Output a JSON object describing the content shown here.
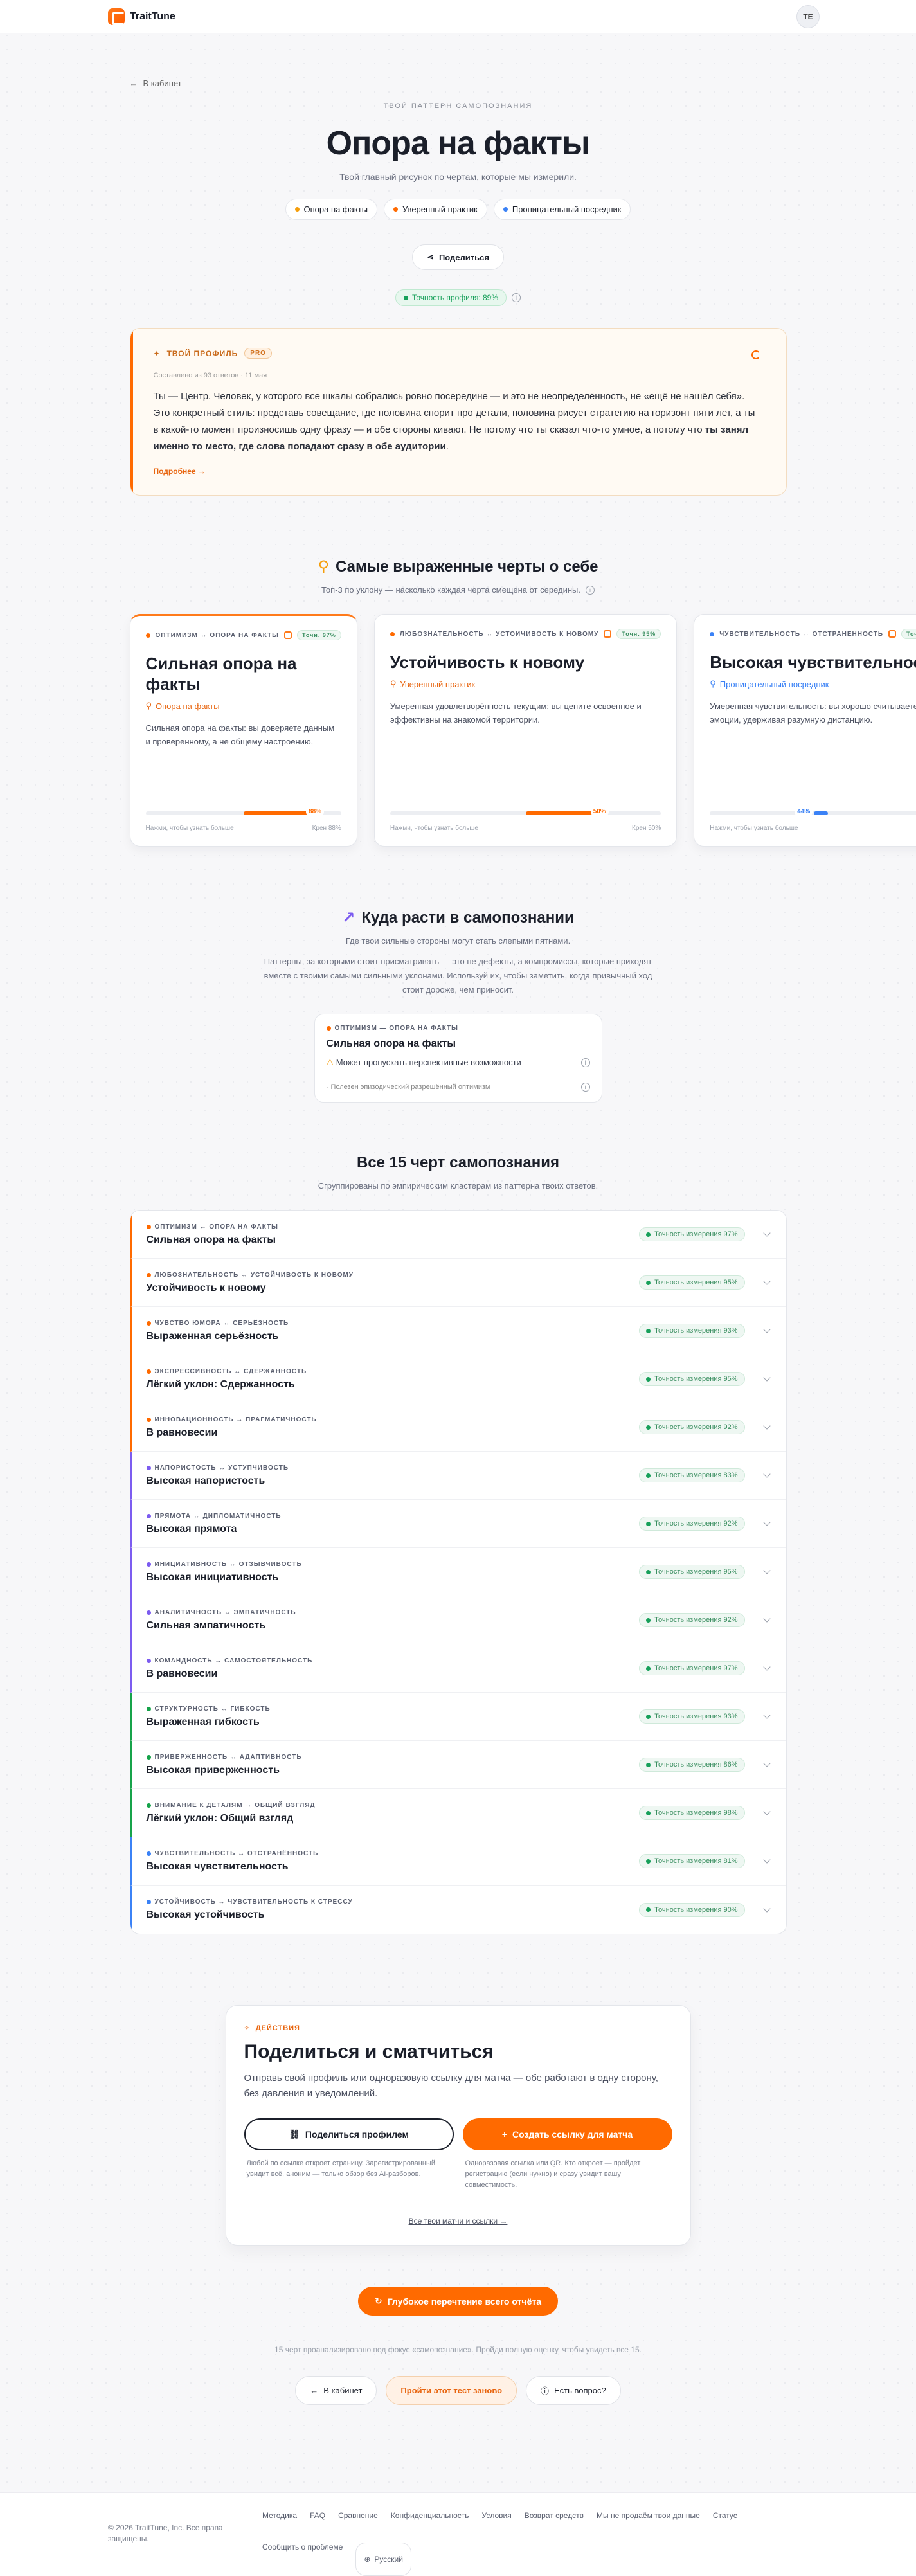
{
  "header": {
    "brand": "TraitTune",
    "avatar": "TE"
  },
  "back": "В кабинет",
  "hero": {
    "eyebrow": "ТВОЙ ПАТТЕРН САМОПОЗНАНИЯ",
    "title": "Опора на факты",
    "subtitle": "Твой главный рисунок по чертам, которые мы измерили.",
    "chips": [
      {
        "label": "Опора на факты",
        "color": "#f59e0b"
      },
      {
        "label": "Уверенный практик",
        "color": "#ff6a00"
      },
      {
        "label": "Проницательный посредник",
        "color": "#3b82f6"
      }
    ],
    "share": "Поделиться",
    "accuracy": "Точность профиля: 89%"
  },
  "profile": {
    "label": "ТВОЙ ПРОФИЛЬ",
    "badge": "PRO",
    "meta": "Составлено из 93 ответов · 11 мая",
    "text": "Ты — Центр. Человек, у которого все шкалы собрались ровно посередине — и это не неопределённость, не «ещё не нашёл себя». Это конкретный стиль: представь совещание, где половина спорит про детали, половина рисует стратегию на горизонт пяти лет, а ты в какой-то момент произносишь одну фразу — и обе стороны кивают. Не потому что ты сказал что-то умное, а потому что",
    "bold": "ты занял именно то место, где слова попадают сразу в обе аудитории",
    "more": "Подробнее →"
  },
  "top": {
    "title": "Самые выраженные черты о себе",
    "subtitle": "Топ-3 по уклону — насколько каждая черта смещена от середины.",
    "cards": [
      {
        "label": "ОПТИМИЗМ ↔ ОПОРА НА ФАКТЫ",
        "acc": "Точн. 97%",
        "title": "Сильная опора на факты",
        "pattern": "Опора на факты",
        "pcolor": "#e8650f",
        "dot": "#ff6a00",
        "desc": "Сильная опора на факты: вы доверяете данным и проверенному, а не общему настроению.",
        "value": 0.88,
        "vlabel": "88%",
        "bcolor": "#ff6a00",
        "hint": "Нажми, чтобы узнать больше",
        "pole": "Крен 88%"
      },
      {
        "label": "ЛЮБОЗНАТЕЛЬНОСТЬ ↔ УСТОЙЧИВОСТЬ К НОВОМУ",
        "acc": "Точн. 95%",
        "title": "Устойчивость к новому",
        "pattern": "Уверенный практик",
        "pcolor": "#e8650f",
        "dot": "#ff6a00",
        "desc": "Умеренная удовлетворённость текущим: вы цените освоенное и эффективны на знакомой территории.",
        "value": 0.8,
        "vlabel": "50%",
        "bcolor": "#ff6a00",
        "hint": "Нажми, чтобы узнать больше",
        "pole": "Крен 50%"
      },
      {
        "label": "ЧУВСТВИТЕЛЬНОСТЬ ↔ ОТСТРАНЁННОСТЬ",
        "acc": "Точн. 81%",
        "title": "Высокая чувствительность",
        "pattern": "Проницательный посредник",
        "pcolor": "#3b82f6",
        "dot": "#3b82f6",
        "desc": "Умеренная чувствительность: вы хорошо считываете эмоции, удерживая разумную дистанцию.",
        "value": 0.44,
        "vlabel": "44%",
        "bcolor": "#3b82f6",
        "hint": "Нажми, чтобы узнать больше",
        "pole": "Крен 44%"
      }
    ]
  },
  "growth": {
    "title": "Куда расти в самопознании",
    "subtitle": "Где твои сильные стороны могут стать слепыми пятнами.",
    "text": "Паттерны, за которыми стоит присматривать — это не дефекты, а компромиссы, которые приходят вместе с твоими самыми сильными уклонами. Используй их, чтобы заметить, когда привычный ход стоит дороже, чем приносит.",
    "card": {
      "label": "ОПТИМИЗМ — ОПОРА НА ФАКТЫ",
      "title": "Сильная опора на факты",
      "risk": "Может пропускать перспективные возможности",
      "note": "Полезен эпизодический разрешённый оптимизм"
    }
  },
  "all": {
    "title": "Все 15 черт самопознания",
    "subtitle": "Сгруппированы по эмпирическим кластерам из паттерна твоих ответов.",
    "rows": [
      {
        "pair": "ОПТИМИЗМ ↔ ОПОРА НА ФАКТЫ",
        "name": "Сильная опора на факты",
        "acc": "Точность измерения 97%",
        "c": "#ff6a00"
      },
      {
        "pair": "ЛЮБОЗНАТЕЛЬНОСТЬ ↔ УСТОЙЧИВОСТЬ К НОВОМУ",
        "name": "Устойчивость к новому",
        "acc": "Точность измерения 95%",
        "c": "#ff6a00"
      },
      {
        "pair": "ЧУВСТВО ЮМОРА ↔ СЕРЬЁЗНОСТЬ",
        "name": "Выраженная серьёзность",
        "acc": "Точность измерения 93%",
        "c": "#ff6a00"
      },
      {
        "pair": "ЭКСПРЕССИВНОСТЬ ↔ СДЕРЖАННОСТЬ",
        "name": "Лёгкий уклон: Сдержанность",
        "acc": "Точность измерения 95%",
        "c": "#ff6a00"
      },
      {
        "pair": "ИННОВАЦИОННОСТЬ ↔ ПРАГМАТИЧНОСТЬ",
        "name": "В равновесии",
        "acc": "Точность измерения 92%",
        "c": "#ff6a00"
      },
      {
        "pair": "НАПОРИСТОСТЬ ↔ УСТУПЧИВОСТЬ",
        "name": "Высокая напористость",
        "acc": "Точность измерения 83%",
        "c": "#7c5cf0"
      },
      {
        "pair": "ПРЯМОТА ↔ ДИПЛОМАТИЧНОСТЬ",
        "name": "Высокая прямота",
        "acc": "Точность измерения 92%",
        "c": "#7c5cf0"
      },
      {
        "pair": "ИНИЦИАТИВНОСТЬ ↔ ОТЗЫВЧИВОСТЬ",
        "name": "Высокая инициативность",
        "acc": "Точность измерения 95%",
        "c": "#7c5cf0"
      },
      {
        "pair": "АНАЛИТИЧНОСТЬ ↔ ЭМПАТИЧНОСТЬ",
        "name": "Сильная эмпатичность",
        "acc": "Точность измерения 92%",
        "c": "#7c5cf0"
      },
      {
        "pair": "КОМАНДНОСТЬ ↔ САМОСТОЯТЕЛЬНОСТЬ",
        "name": "В равновесии",
        "acc": "Точность измерения 97%",
        "c": "#7c5cf0"
      },
      {
        "pair": "СТРУКТУРНОСТЬ ↔ ГИБКОСТЬ",
        "name": "Выраженная гибкость",
        "acc": "Точность измерения 93%",
        "c": "#16a34a"
      },
      {
        "pair": "ПРИВЕРЖЕННОСТЬ ↔ АДАПТИВНОСТЬ",
        "name": "Высокая приверженность",
        "acc": "Точность измерения 86%",
        "c": "#16a34a"
      },
      {
        "pair": "ВНИМАНИЕ К ДЕТАЛЯМ ↔ ОБЩИЙ ВЗГЛЯД",
        "name": "Лёгкий уклон: Общий взгляд",
        "acc": "Точность измерения 98%",
        "c": "#16a34a"
      },
      {
        "pair": "ЧУВСТВИТЕЛЬНОСТЬ ↔ ОТСТРАНЁННОСТЬ",
        "name": "Высокая чувствительность",
        "acc": "Точность измерения 81%",
        "c": "#3b82f6"
      },
      {
        "pair": "УСТОЙЧИВОСТЬ ↔ ЧУВСТВИТЕЛЬНОСТЬ К СТРЕССУ",
        "name": "Высокая устойчивость",
        "acc": "Точность измерения 90%",
        "c": "#3b82f6"
      }
    ]
  },
  "actions": {
    "eyebrow": "ДЕЙСТВИЯ",
    "title": "Поделиться и сматчиться",
    "subtitle": "Отправь свой профиль или одноразовую ссылку для матча — обе работают в одну сторону, без давления и уведомлений.",
    "share_btn": "Поделиться профилем",
    "match_btn": "Создать ссылку для матча",
    "note1": "Любой по ссылке откроет страницу. Зарегистрированный увидит всё, аноним — только обзор без AI-разборов.",
    "note2": "Одноразовая ссылка или QR. Кто откроет — пройдет регистрацию (если нужно) и сразу увидит вашу совместимость.",
    "all_link": "Все твои матчи и ссылки →"
  },
  "deep": "Глубокое перечтение всего отчёта",
  "note": "15 черт проанализировано под фокус «самопознание». Пройди полную оценку, чтобы увидеть все 15.",
  "bottom": {
    "cabinet": "В кабинет",
    "retake": "Пройти этот тест заново",
    "question": "Есть вопрос?"
  },
  "footer": {
    "copy": "© 2026 TraitTune, Inc. Все права защищены.",
    "links": [
      "Методика",
      "FAQ",
      "Сравнение",
      "Конфиденциальность",
      "Условия",
      "Возврат средств",
      "Мы не продаём твои данные",
      "Статус",
      "Сообщить о проблеме"
    ],
    "lang": "Русский"
  }
}
